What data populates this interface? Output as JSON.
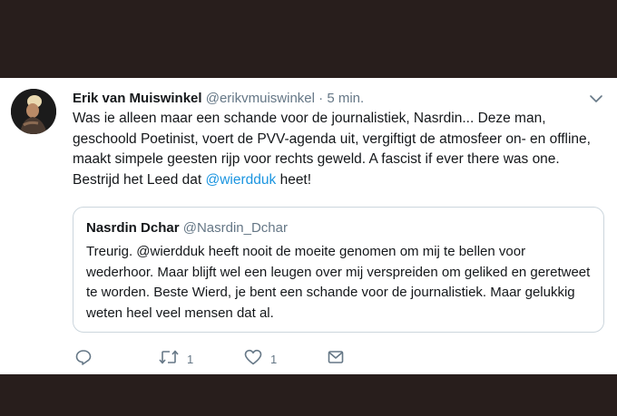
{
  "tweet": {
    "author_name": "Erik van Muiswinkel",
    "author_handle": "@erikvmuiswinkel",
    "separator": "·",
    "time": "5 min.",
    "text_before_mention": "Was ie alleen maar een schande voor de journalistiek, Nasrdin... Deze man, geschoold Poetinist, voert de PVV-agenda uit, vergiftigt de atmosfeer on- en offline, maakt simpele geesten rijp voor rechts geweld. A fascist if ever there was one. Bestrijd het Leed dat ",
    "mention": "@wierdduk",
    "text_after_mention": " heet!"
  },
  "quoted_tweet": {
    "author_name": "Nasrdin Dchar",
    "author_handle": "@Nasrdin_Dchar",
    "text": "Treurig. @wierdduk heeft nooit de moeite genomen om mij te bellen voor wederhoor. Maar blijft wel een leugen over mij verspreiden om geliked en geretweet te worden. Beste Wierd, je bent een schande voor de journalistiek. Maar gelukkig weten heel veel mensen dat al."
  },
  "actions": {
    "retweet_count": "1",
    "like_count": "1"
  },
  "colors": {
    "background": "#281e1c",
    "link": "#1b95e0",
    "muted": "#657786",
    "border": "#ccd6dd"
  },
  "icons": [
    "reply-icon",
    "retweet-icon",
    "like-icon",
    "dm-icon",
    "chevron-down-icon"
  ]
}
